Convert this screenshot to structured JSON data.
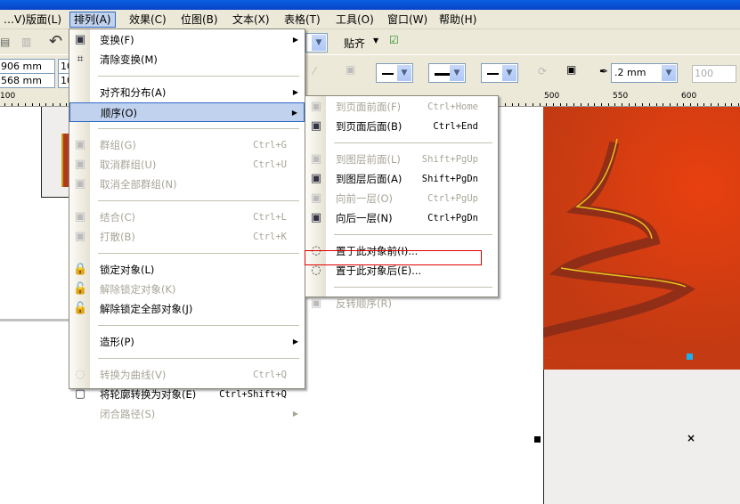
{
  "menubar": [
    "…V)",
    "版面(L)",
    "排列(A)",
    "效果(C)",
    "位图(B)",
    "文本(X)",
    "表格(T)",
    "工具(O)",
    "窗口(W)",
    "帮助(H)"
  ],
  "toolbar": {
    "snap_label": "贴齐",
    "width_value": "906 mm",
    "height_value": "568 mm",
    "scale_x": "10",
    "scale_y": "10",
    "outline_width": ".2 mm",
    "opacity": "100"
  },
  "ruler": {
    "labels": [
      "100",
      "500",
      "550",
      "600"
    ]
  },
  "arrange_menu": [
    {
      "label": "变换(F)",
      "submenu": true,
      "icon": "transform-icon"
    },
    {
      "label": "清除变换(M)",
      "icon": "clear-transform-icon"
    },
    {
      "sep": true
    },
    {
      "label": "对齐和分布(A)",
      "submenu": true
    },
    {
      "label": "顺序(O)",
      "submenu": true,
      "highlighted": true
    },
    {
      "sep": true
    },
    {
      "label": "群组(G)",
      "shortcut": "Ctrl+G",
      "disabled": true,
      "icon": "group-icon"
    },
    {
      "label": "取消群组(U)",
      "shortcut": "Ctrl+U",
      "disabled": true,
      "icon": "ungroup-icon"
    },
    {
      "label": "取消全部群组(N)",
      "disabled": true,
      "icon": "ungroup-all-icon"
    },
    {
      "sep": true
    },
    {
      "label": "结合(C)",
      "shortcut": "Ctrl+L",
      "disabled": true,
      "icon": "combine-icon"
    },
    {
      "label": "打散(B)",
      "shortcut": "Ctrl+K",
      "disabled": true,
      "icon": "break-apart-icon"
    },
    {
      "sep": true
    },
    {
      "label": "锁定对象(L)",
      "icon": "lock-icon"
    },
    {
      "label": "解除锁定对象(K)",
      "disabled": true,
      "icon": "unlock-icon"
    },
    {
      "label": "解除锁定全部对象(J)",
      "icon": "unlock-all-icon"
    },
    {
      "sep": true
    },
    {
      "label": "造形(P)",
      "submenu": true
    },
    {
      "sep": true
    },
    {
      "label": "转换为曲线(V)",
      "shortcut": "Ctrl+Q",
      "disabled": true,
      "icon": "convert-to-curves-icon"
    },
    {
      "label": "将轮廓转换为对象(E)",
      "shortcut": "Ctrl+Shift+Q",
      "icon": "outline-to-object-icon"
    },
    {
      "label": "闭合路径(S)",
      "submenu": true,
      "disabled": true
    }
  ],
  "order_submenu": [
    {
      "label": "到页面前面(F)",
      "shortcut": "Ctrl+Home",
      "disabled": true,
      "icon": "to-page-front-icon"
    },
    {
      "label": "到页面后面(B)",
      "shortcut": "Ctrl+End",
      "icon": "to-page-back-icon"
    },
    {
      "sep": true
    },
    {
      "label": "到图层前面(L)",
      "shortcut": "Shift+PgUp",
      "disabled": true,
      "icon": "to-layer-front-icon"
    },
    {
      "label": "到图层后面(A)",
      "shortcut": "Shift+PgDn",
      "icon": "to-layer-back-icon"
    },
    {
      "label": "向前一层(O)",
      "shortcut": "Ctrl+PgUp",
      "disabled": true,
      "icon": "forward-one-icon"
    },
    {
      "label": "向后一层(N)",
      "shortcut": "Ctrl+PgDn",
      "icon": "back-one-icon"
    },
    {
      "sep": true
    },
    {
      "label": "置于此对象前(I)...",
      "icon": "in-front-of-icon"
    },
    {
      "label": "置于此对象后(E)...",
      "icon": "behind-icon",
      "boxed": true
    },
    {
      "sep": true
    },
    {
      "label": "反转顺序(R)",
      "disabled": true,
      "icon": "reverse-order-icon"
    }
  ],
  "colors": {
    "highlight": "#c1d2ee",
    "highlight_border": "#316ac5",
    "annotation": "#e00000",
    "artwork": "#d23c10"
  }
}
